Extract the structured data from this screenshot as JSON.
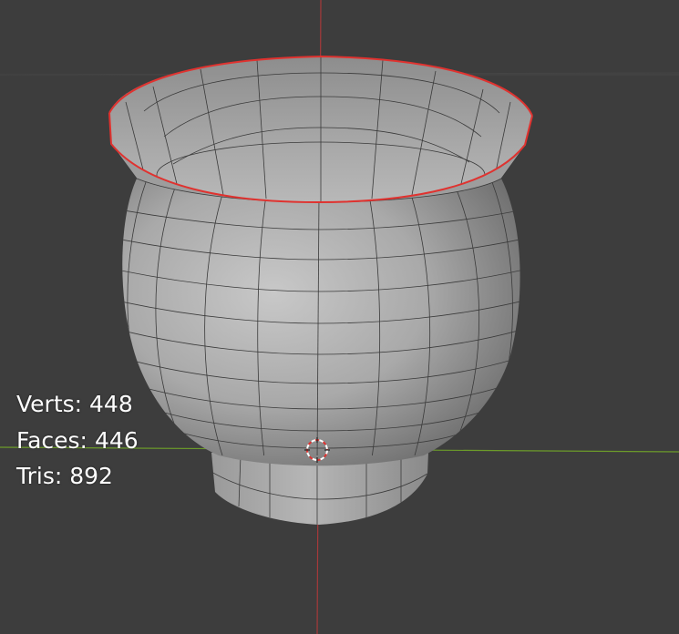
{
  "viewport": {
    "background_color": "#3d3d3d",
    "x_axis_color": "#6c9b2a",
    "z_axis_color": "#a6393a",
    "grid_color": "#474747",
    "selection_outline_color": "#e0322f",
    "mesh_color": "#a0a0a0"
  },
  "overlay_stats": {
    "verts_label": "Verts:",
    "verts_value": "448",
    "faces_label": "Faces:",
    "faces_value": "446",
    "tris_label": "Tris:",
    "tris_value": "892"
  },
  "icons": {
    "cursor": "3d-cursor-icon"
  }
}
